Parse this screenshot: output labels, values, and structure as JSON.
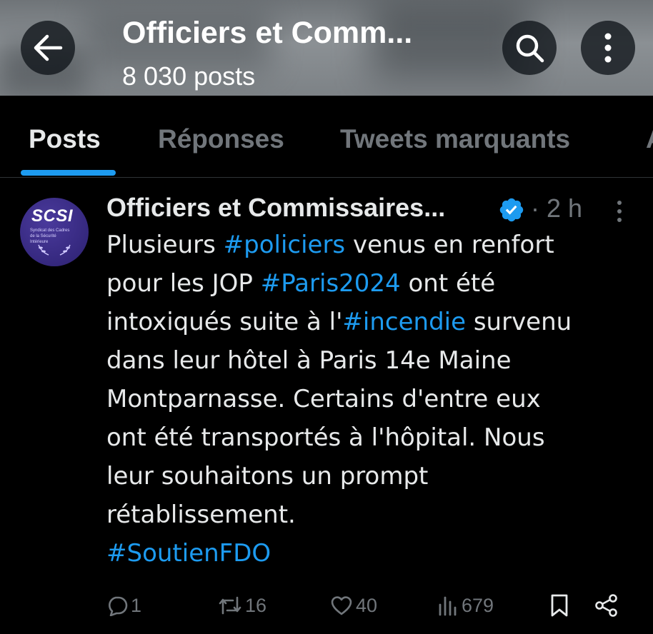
{
  "header": {
    "title": "Officiers et Comm...",
    "post_count": "8 030 posts",
    "back_icon": "arrow-left-icon",
    "search_icon": "search-icon",
    "more_icon": "more-vertical-icon"
  },
  "tabs": [
    {
      "label": "Posts",
      "active": true
    },
    {
      "label": "Réponses",
      "active": false
    },
    {
      "label": "Tweets marquants",
      "active": false
    },
    {
      "label": "A",
      "active": false
    }
  ],
  "tweet": {
    "avatar_text": "SCSI",
    "avatar_subtext": "Syndicat des Cadres de la Sécurité Intérieure",
    "author_name": "Officiers et Commissaires...",
    "verified": true,
    "separator": "·",
    "time": "2 h",
    "lines": [
      [
        {
          "t": "Plusieurs ",
          "h": false
        },
        {
          "t": "#policiers",
          "h": true
        },
        {
          "t": " venus en renfort",
          "h": false
        }
      ],
      [
        {
          "t": "pour les JOP ",
          "h": false
        },
        {
          "t": "#Paris2024",
          "h": true
        },
        {
          "t": " ont été",
          "h": false
        }
      ],
      [
        {
          "t": "intoxiqués suite à l'",
          "h": false
        },
        {
          "t": "#incendie",
          "h": true
        },
        {
          "t": " survenu",
          "h": false
        }
      ],
      [
        {
          "t": "dans leur hôtel à Paris 14e Maine",
          "h": false
        }
      ],
      [
        {
          "t": "Montparnasse. Certains d'entre eux",
          "h": false
        }
      ],
      [
        {
          "t": "ont été transportés à l'hôpital. Nous",
          "h": false
        }
      ],
      [
        {
          "t": "leur souhaitons un prompt",
          "h": false
        }
      ],
      [
        {
          "t": "rétablissement.",
          "h": false
        }
      ],
      [
        {
          "t": "#SoutienFDO",
          "h": true
        }
      ]
    ],
    "actions": {
      "replies": "1",
      "retweets": "16",
      "likes": "40",
      "views": "679"
    }
  },
  "colors": {
    "accent": "#1d9bf0",
    "muted": "#71767b",
    "text": "#e7e9ea",
    "background": "#000000"
  }
}
